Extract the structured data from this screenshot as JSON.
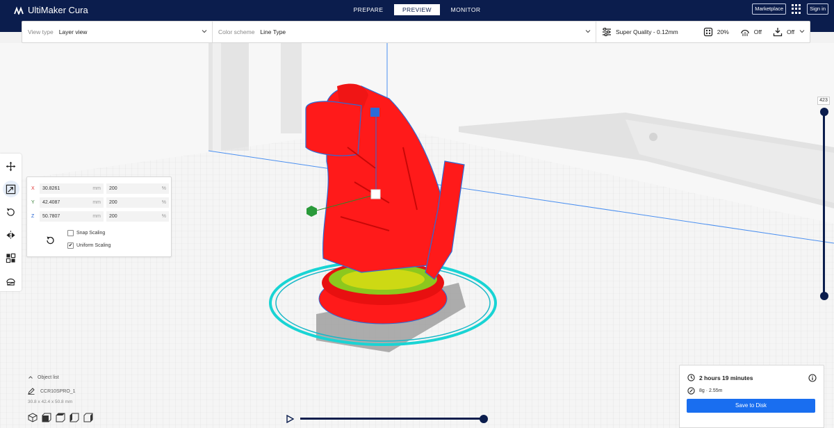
{
  "app": {
    "title": "UltiMaker Cura"
  },
  "nav": {
    "tabs": [
      "PREPARE",
      "PREVIEW",
      "MONITOR"
    ],
    "active": "PREVIEW"
  },
  "header": {
    "marketplace": "Marketplace",
    "signin": "Sign in",
    "apps_icon": "grid-apps-icon"
  },
  "settings_bar": {
    "view_type_label": "View type",
    "view_type_value": "Layer view",
    "color_scheme_label": "Color scheme",
    "color_scheme_value": "Line Type",
    "quality": "Super Quality - 0.12mm",
    "infill": "20%",
    "support": "Off",
    "adhesion": "Off"
  },
  "scale_panel": {
    "rows": [
      {
        "axis": "X",
        "axis_color": "#e03030",
        "mm": "30.8261",
        "mm_unit": "mm",
        "pct": "200",
        "pct_unit": "%"
      },
      {
        "axis": "Y",
        "axis_color": "#2f7a2f",
        "mm": "42.4087",
        "mm_unit": "mm",
        "pct": "200",
        "pct_unit": "%"
      },
      {
        "axis": "Z",
        "axis_color": "#2060d0",
        "mm": "50.7807",
        "mm_unit": "mm",
        "pct": "200",
        "pct_unit": "%"
      }
    ],
    "snap_scaling": {
      "label": "Snap Scaling",
      "checked": false,
      "mark": ""
    },
    "uniform_scaling": {
      "label": "Uniform Scaling",
      "checked": true,
      "mark": "✔"
    }
  },
  "layer_slider": {
    "current_layer": "423"
  },
  "object_list": {
    "header": "Object list",
    "object_name": "CCR10SPRO_1",
    "dimensions": "30.8 x 42.4 x 50.8 mm"
  },
  "print_info": {
    "time": "2 hours 19 minutes",
    "material": "8g · 2.55m",
    "save_button": "Save to Disk"
  },
  "colors": {
    "navy": "#0b1d4d",
    "accent_blue": "#196ef0",
    "model_red": "#ff1a1a"
  }
}
